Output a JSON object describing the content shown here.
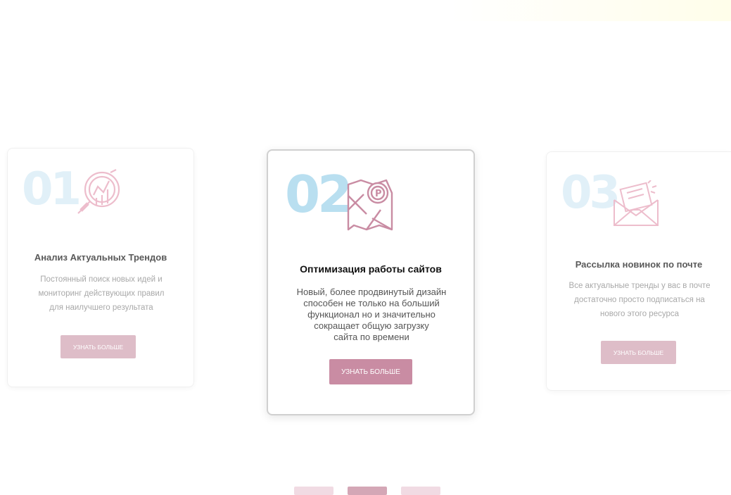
{
  "cards": [
    {
      "number": "01",
      "title": "Анализ Актуальных Трендов",
      "desc_lines": [
        "Постоянный поиск новых идей и",
        "мониторинг действующих правил",
        "для наилучшего результата"
      ],
      "button": "узнать больше",
      "icon": "magnifier-chart-icon"
    },
    {
      "number": "02",
      "title": "Оптимизация работы сайтов",
      "desc_lines": [
        "Новый, более продвинутый дизайн",
        "способен не только на больший",
        "функционал но и значительно",
        "сокращает общую загрузку",
        "сайта по времени"
      ],
      "button": "узнать больше",
      "icon": "map-pin-icon"
    },
    {
      "number": "03",
      "title": "Рассылка новинок по почте",
      "desc_lines": [
        "Все актуальные тренды у вас в почте",
        "достаточно просто подписаться на",
        "нового этого ресурса"
      ],
      "button": "узнать больше",
      "icon": "envelope-letter-icon"
    }
  ],
  "pagination": {
    "count": 3,
    "active_index": 1
  },
  "colors": {
    "accent": "#c98ca3",
    "accent_light": "#d4a7b6",
    "number": "#b9dff0"
  }
}
